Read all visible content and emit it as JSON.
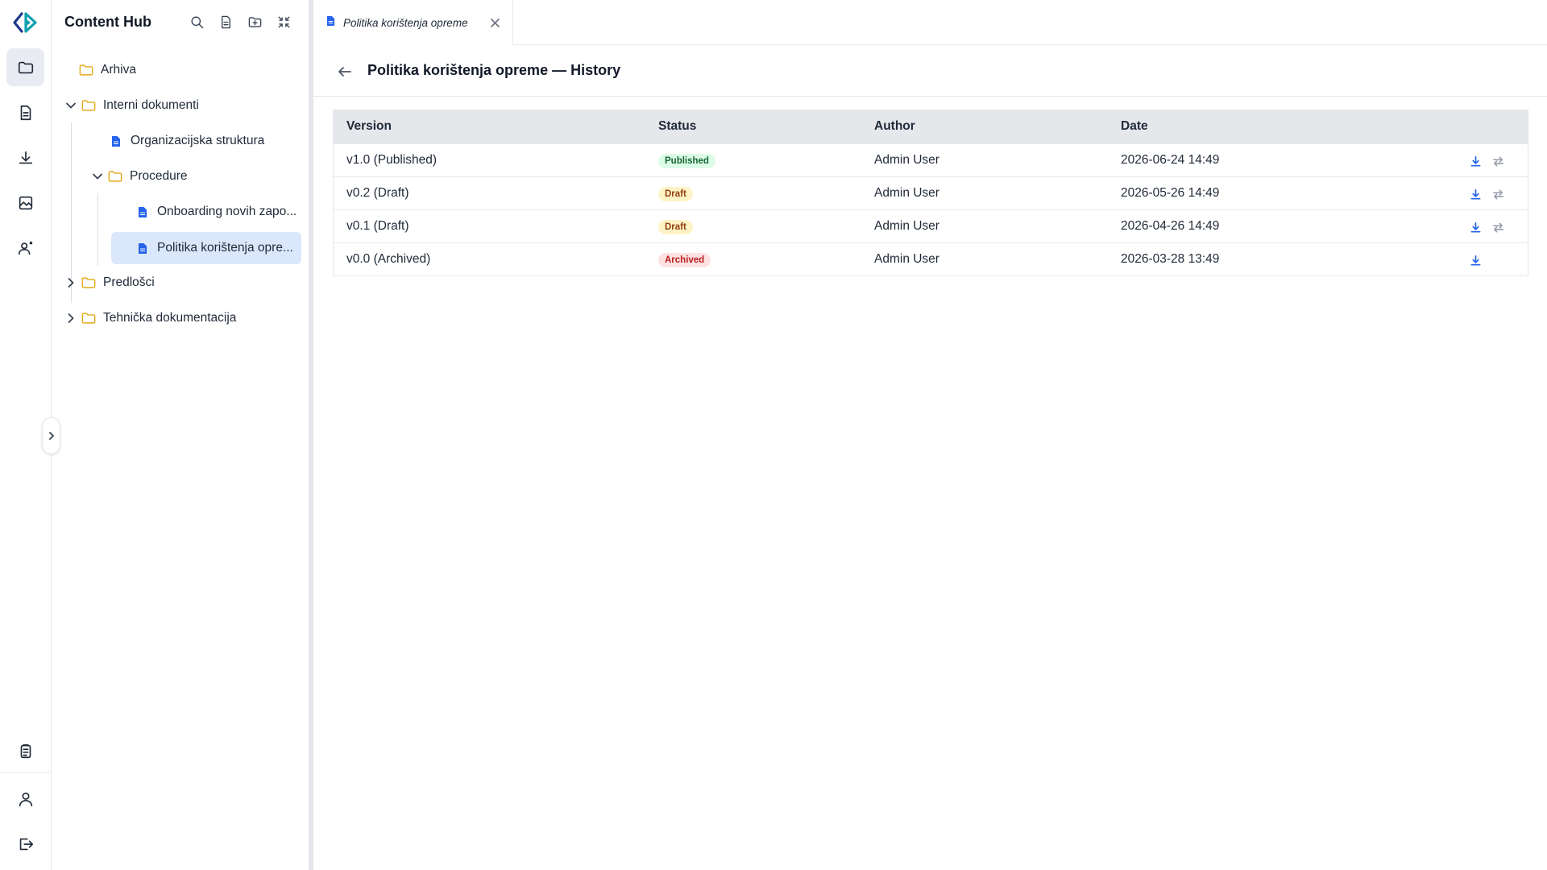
{
  "app": {
    "title": "Content Hub",
    "accent": "#2563eb",
    "logo_colors": [
      "#0f9fb0",
      "#1e3a8a"
    ]
  },
  "rail": {
    "items": [
      {
        "icon": "folder-icon",
        "active": true
      },
      {
        "icon": "document-icon",
        "active": false
      },
      {
        "icon": "download-icon",
        "active": false
      },
      {
        "icon": "image-icon",
        "active": false
      },
      {
        "icon": "users-settings-icon",
        "active": false
      }
    ],
    "bottom": [
      {
        "icon": "clipboard-icon"
      },
      {
        "icon": "user-icon"
      },
      {
        "icon": "logout-icon"
      }
    ]
  },
  "sidebar": {
    "title": "Content Hub",
    "tools": [
      "search-icon",
      "new-document-icon",
      "new-folder-icon",
      "collapse-all-icon"
    ],
    "tree": [
      {
        "label": "Arhiva",
        "type": "folder",
        "expanded": null
      },
      {
        "label": "Interni dokumenti",
        "type": "folder",
        "expanded": true
      },
      {
        "label": "Organizacijska struktura",
        "type": "document"
      },
      {
        "label": "Procedure",
        "type": "folder",
        "expanded": true
      },
      {
        "label": "Onboarding novih zapo...",
        "type": "document"
      },
      {
        "label": "Politika korištenja opre...",
        "type": "document",
        "selected": true
      },
      {
        "label": "Predlošci",
        "type": "folder",
        "expanded": false
      },
      {
        "label": "Tehnička dokumentacija",
        "type": "folder",
        "expanded": false
      }
    ]
  },
  "tabs": [
    {
      "label": "Politika korištenja opreme",
      "active": true
    }
  ],
  "page": {
    "title": "Politika korištenja opreme — History"
  },
  "history": {
    "columns": [
      "Version",
      "Status",
      "Author",
      "Date"
    ],
    "rows": [
      {
        "version": "v1.0 (Published)",
        "status": "Published",
        "author": "Admin User",
        "date": "2026-06-24 14:49",
        "compare": true
      },
      {
        "version": "v0.2 (Draft)",
        "status": "Draft",
        "author": "Admin User",
        "date": "2026-05-26 14:49",
        "compare": true
      },
      {
        "version": "v0.1 (Draft)",
        "status": "Draft",
        "author": "Admin User",
        "date": "2026-04-26 14:49",
        "compare": true
      },
      {
        "version": "v0.0 (Archived)",
        "status": "Archived",
        "author": "Admin User",
        "date": "2026-03-28 13:49",
        "compare": false
      }
    ]
  }
}
